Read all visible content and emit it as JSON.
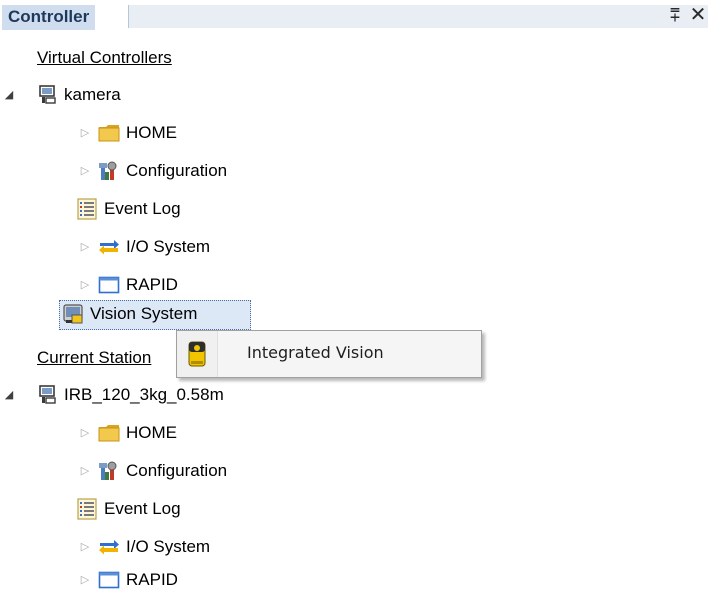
{
  "panel": {
    "title": "Controller",
    "pin_glyph": "⩱",
    "close_glyph": "✕"
  },
  "tree": {
    "virtual_controllers": {
      "label": "Virtual Controllers",
      "controller": {
        "name": "kamera",
        "icon": "controller-icon",
        "children": [
          {
            "label": "HOME",
            "icon": "folder-icon",
            "expandable": true
          },
          {
            "label": "Configuration",
            "icon": "configuration-icon",
            "expandable": true
          },
          {
            "label": "Event Log",
            "icon": "event-log-icon",
            "expandable": false
          },
          {
            "label": "I/O System",
            "icon": "io-system-icon",
            "expandable": true
          },
          {
            "label": "RAPID",
            "icon": "rapid-icon",
            "expandable": true
          },
          {
            "label": "Vision System",
            "icon": "vision-system-icon",
            "expandable": false,
            "selected": true
          }
        ]
      }
    },
    "current_station": {
      "label": "Current Station",
      "controller": {
        "name": "IRB_120_3kg_0.58m",
        "icon": "controller-icon",
        "children": [
          {
            "label": "HOME",
            "icon": "folder-icon",
            "expandable": true
          },
          {
            "label": "Configuration",
            "icon": "configuration-icon",
            "expandable": true
          },
          {
            "label": "Event Log",
            "icon": "event-log-icon",
            "expandable": false
          },
          {
            "label": "I/O System",
            "icon": "io-system-icon",
            "expandable": true
          },
          {
            "label": "RAPID",
            "icon": "rapid-icon",
            "expandable": true
          }
        ]
      }
    }
  },
  "context_menu": {
    "items": [
      {
        "label": "Integrated Vision",
        "icon": "integrated-vision-icon"
      }
    ]
  },
  "colors": {
    "header_tab": "#cfddee",
    "header_title": "#1e395b",
    "selection_bg": "#dde8f6",
    "folder": "#f2c94c",
    "menu_bg": "#f5f5f5"
  }
}
